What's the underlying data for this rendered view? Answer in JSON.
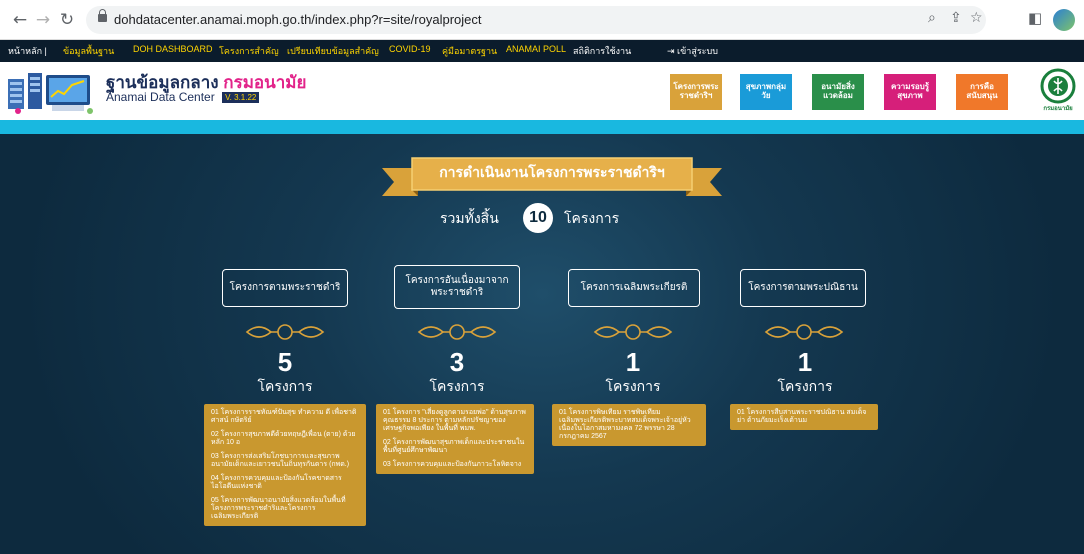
{
  "browser": {
    "url": "dohdatacenter.anamai.moph.go.th/index.php?r=site/royalproject",
    "icons": [
      "back-arrow",
      "forward-arrow",
      "reload",
      "lock",
      "zoom",
      "share",
      "bookmark-star",
      "sidebar",
      "profile"
    ]
  },
  "topnav": {
    "items": [
      "หน้าหลัก |",
      "ข้อมูลพื้นฐาน",
      "DOH DASHBOARD",
      "โครงการสำคัญ",
      "เปรียบเทียบข้อมูลสำคัญ",
      "COVID-19",
      "คู่มือมาตรฐาน",
      "ANAMAI POLL",
      "สถิติการใช้งาน"
    ],
    "login": "เข้าสู่ระบบ"
  },
  "header": {
    "title_main": "ฐานข้อมูลกลาง",
    "title_accent": "กรมอนามัย",
    "subtitle": "Anamai Data Center",
    "version": "V. 3.1.22",
    "buttons": [
      {
        "label": "โครงการพระราชดำริฯ",
        "color": "#d9a23a"
      },
      {
        "label": "สุขภาพกลุ่มวัย",
        "color": "#1a9bd8"
      },
      {
        "label": "อนามัยสิ่งแวดล้อม",
        "color": "#2a8f4a"
      },
      {
        "label": "ความรอบรู้สุขภาพ",
        "color": "#d61f7a"
      },
      {
        "label": "การคือสนับสนุน",
        "color": "#f0782a"
      }
    ],
    "dept_logo_text": "กรมอนามัย"
  },
  "main": {
    "banner_title": "การดำเนินงานโครงการพระราชดำริฯ",
    "total_label": "รวมทั้งสิ้น",
    "total_count": "10",
    "total_unit": "โครงการ",
    "categories": [
      {
        "title": "โครงการตามพระราชดำริ",
        "count": "5",
        "unit": "โครงการ",
        "items": [
          "01 โครงการราชทัณฑ์ปันสุข ทำความ ดี เพื่อชาติ ศาสน์ กษัตริย์",
          "02 โครงการสุขภาพดีด้วยทฤษฎีเพื่อน (ตาย) ด้วยหลัก 10 อ",
          "03 โครงการส่งเสริมโภชนาการและสุขภาพอนามัยเด็กและเยาวชนในถิ่นทุรกันดาร (กพด.)",
          "04 โครงการควบคุมและป้องกันโรคขาดสารไอโอดีนแห่งชาติ",
          "05 โครงการพัฒนาอนามัยสิ่งแวดล้อมในพื้นที่โครงการพระราชดำริและโครงการเฉลิมพระเกียรติ"
        ]
      },
      {
        "title": "โครงการอันเนื่องมาจากพระราชดำริ",
        "count": "3",
        "unit": "โครงการ",
        "items": [
          "01 โครงการ \"เสี่ยงดูลูกตามรอยพ่อ\" ด้านสุขภาพ คุณธรรม 8 ประการ ตามหลักปรัชญาของเศรษฐกิจพอเพียง ในพื้นที่ พมพ.",
          "02 โครงการพัฒนาสุขภาพเด็กและประชาชนในพื้นที่ศูนย์ศึกษาพัฒนา",
          "03 โครงการควบคุมและป้องกันภาวะโลหิตจาง"
        ]
      },
      {
        "title": "โครงการเฉลิมพระเกียรติ",
        "count": "1",
        "unit": "โครงการ",
        "items": [
          "01 โครงการพิษเทียม ราชพิษเทียม เฉลิมพระเกียรติพระบาทสมเด็จพระเจ้าอยู่หัว เนื่องในโอกาสมหามงคล 72 พรรษา 28 กรกฎาคม 2567"
        ]
      },
      {
        "title": "โครงการตามพระปณิธาน",
        "count": "1",
        "unit": "โครงการ",
        "items": [
          "01 โครงการสืบสานพระราชปณิธาน สมเด็จย่า ต้านภัยมะเร็งเต้านม"
        ]
      }
    ]
  }
}
